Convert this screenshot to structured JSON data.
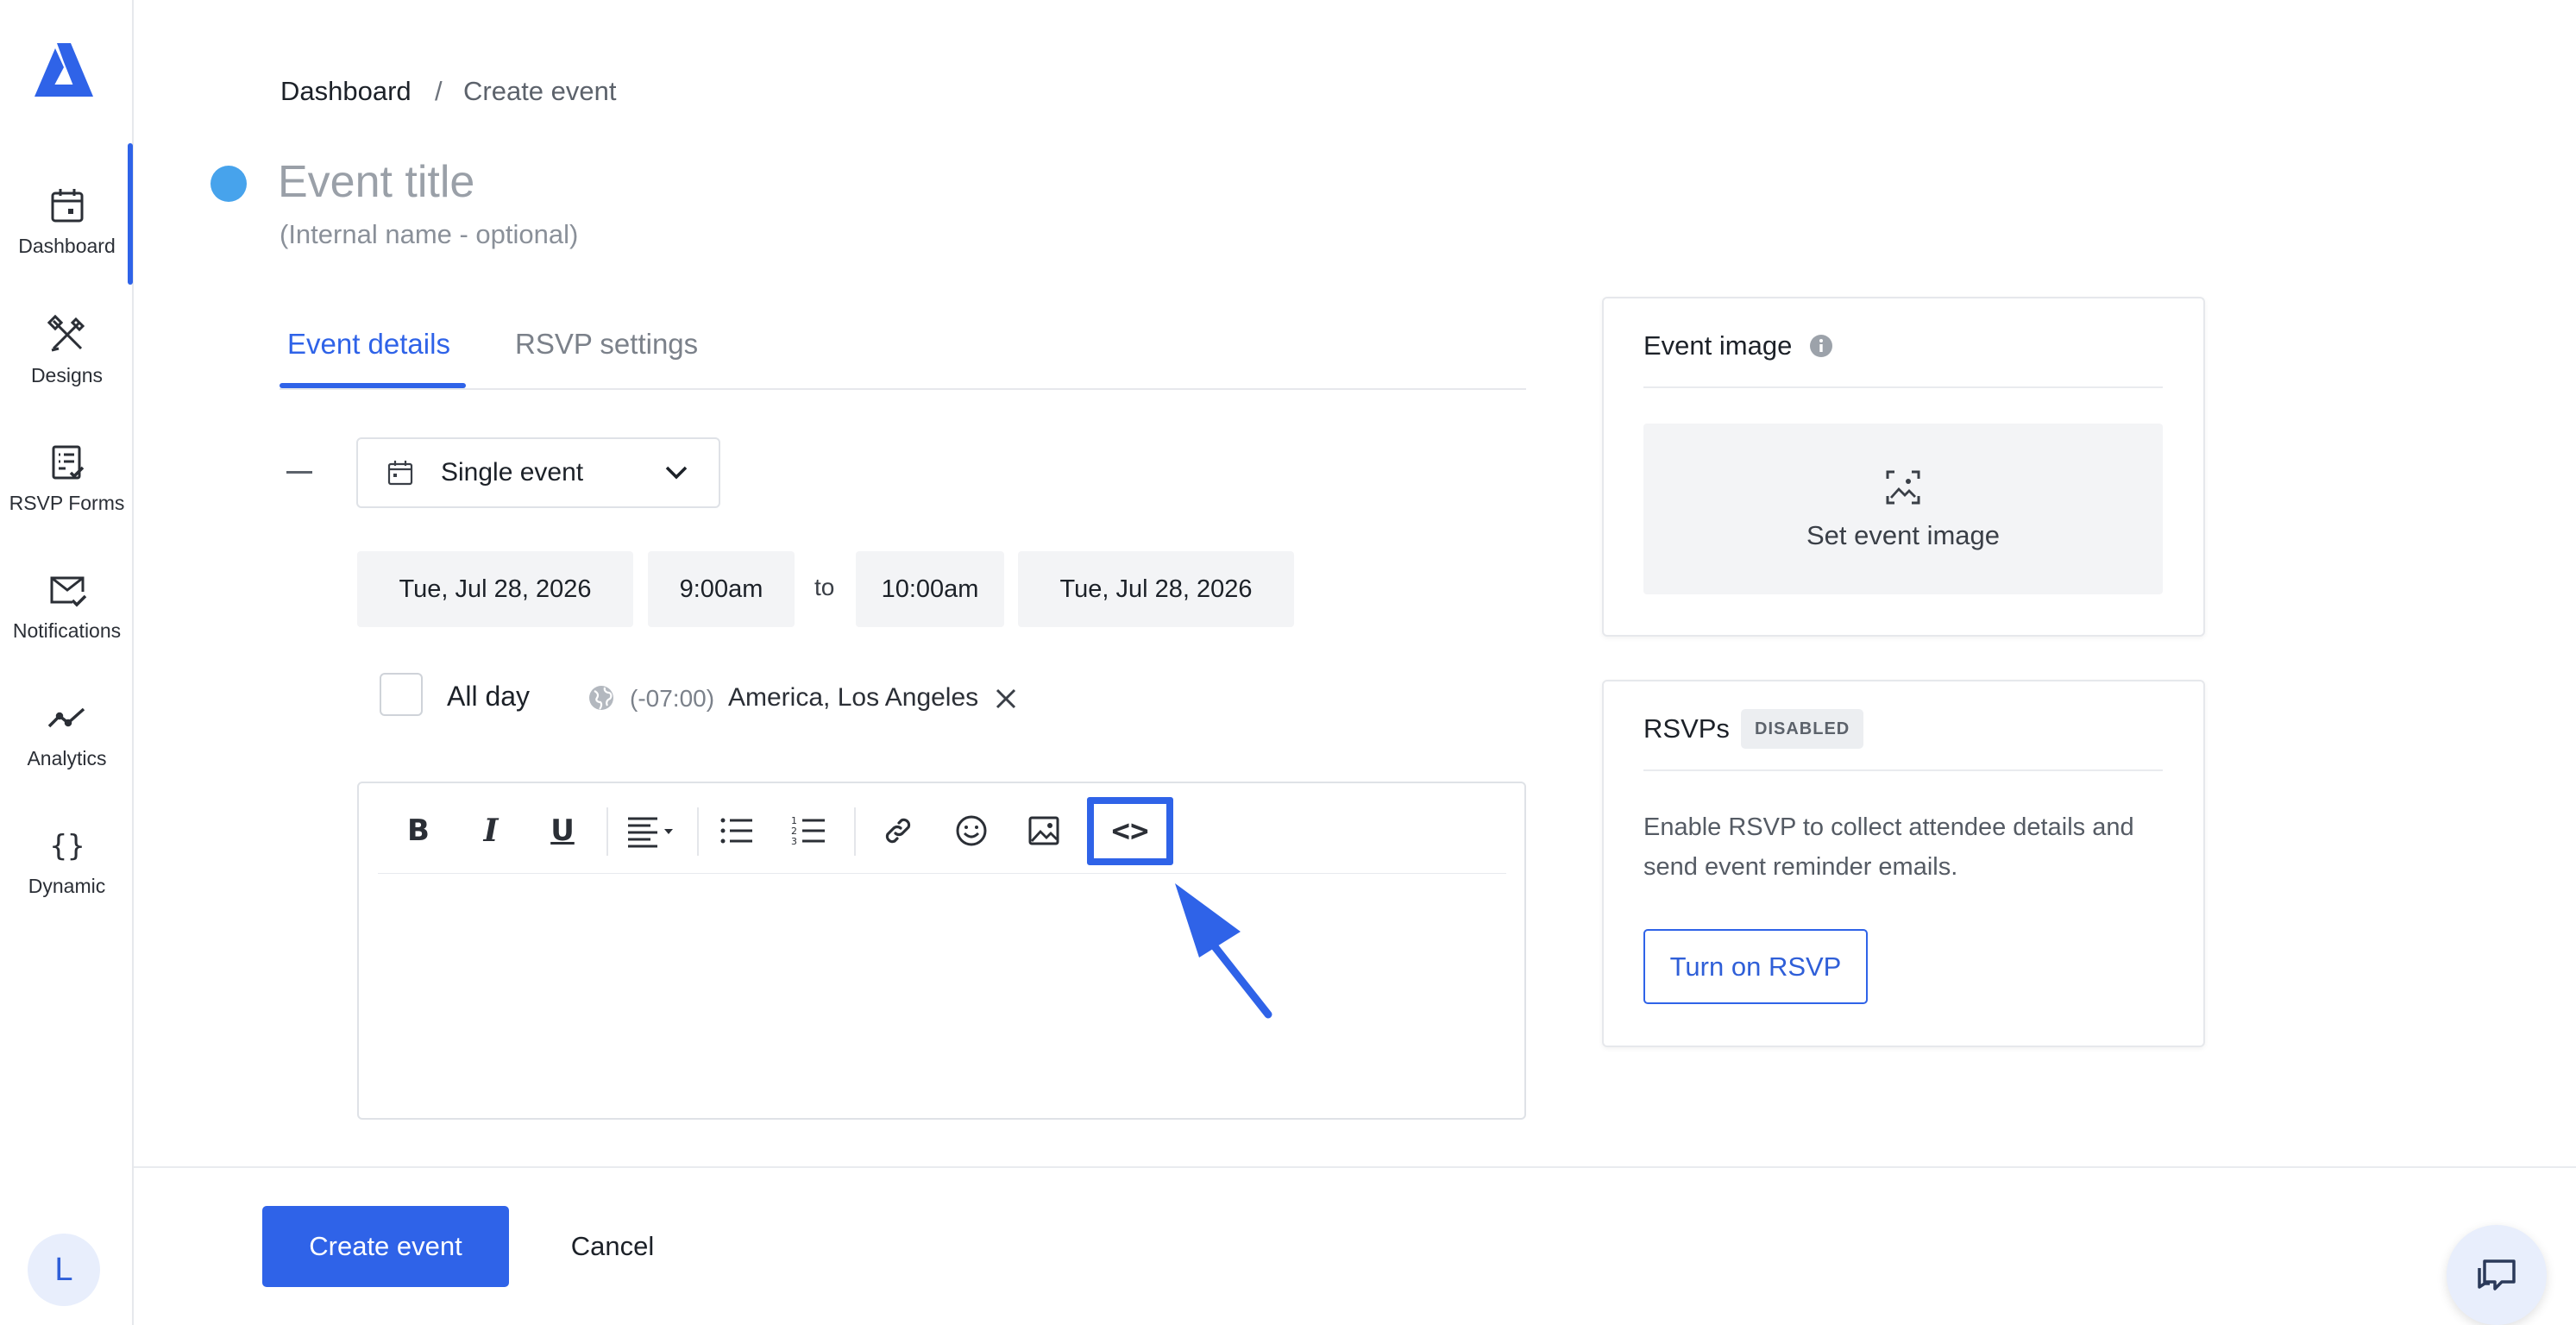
{
  "sidebar": {
    "items": [
      {
        "label": "Dashboard",
        "icon": "calendar-icon"
      },
      {
        "label": "Designs",
        "icon": "design-tools-icon"
      },
      {
        "label": "RSVP Forms",
        "icon": "form-check-icon"
      },
      {
        "label": "Notifications",
        "icon": "mail-check-icon"
      },
      {
        "label": "Analytics",
        "icon": "analytics-line-icon"
      },
      {
        "label": "Dynamic",
        "icon": "curly-braces-icon"
      }
    ],
    "active": "Dashboard",
    "avatar_initial": "L"
  },
  "breadcrumb": {
    "root": "Dashboard",
    "separator": "/",
    "current": "Create event"
  },
  "event": {
    "title_placeholder": "Event title",
    "title_value": "",
    "subtitle": "(Internal name - optional)",
    "color": "#47a3ec"
  },
  "tabs": [
    {
      "label": "Event details",
      "active": true
    },
    {
      "label": "RSVP settings",
      "active": false
    }
  ],
  "schedule": {
    "type": "Single event",
    "start_date": "Tue, Jul 28, 2026",
    "start_time": "9:00am",
    "to_label": "to",
    "end_time": "10:00am",
    "end_date": "Tue, Jul 28, 2026",
    "all_day_label": "All day",
    "all_day_checked": false,
    "timezone_offset": "(-07:00)",
    "timezone_name": "America, Los Angeles"
  },
  "editor": {
    "toolbar": {
      "bold": "B",
      "italic": "I",
      "underline": "U",
      "code_view": "<>"
    },
    "body": ""
  },
  "event_image_card": {
    "title": "Event image",
    "set_label": "Set event image"
  },
  "rsvp_card": {
    "title": "RSVPs",
    "badge": "DISABLED",
    "description": "Enable RSVP to collect attendee details and send event reminder emails.",
    "button": "Turn on RSVP"
  },
  "footer": {
    "create_label": "Create event",
    "cancel_label": "Cancel"
  },
  "colors": {
    "accent": "#2f63e8",
    "event_dot": "#47a3ec",
    "pill_bg": "#f3f4f6"
  }
}
